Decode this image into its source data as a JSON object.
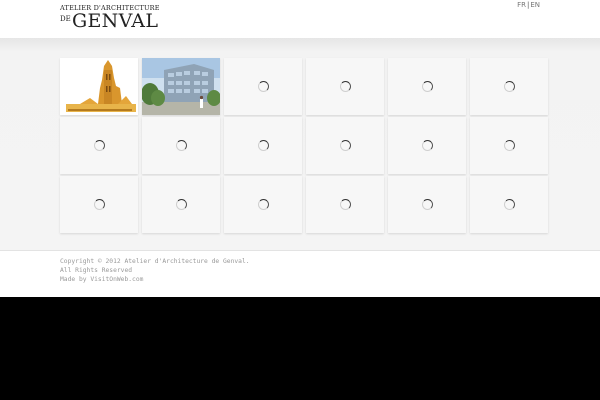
{
  "header": {
    "logo": {
      "line1": "ATELIER D'ARCHITECTURE",
      "de": "DE",
      "name": "GENVAL"
    },
    "lang": {
      "fr": "FR",
      "separator": "|",
      "en": "EN"
    }
  },
  "gallery": {
    "tiles": [
      {
        "type": "image",
        "icon": "cathedral-image"
      },
      {
        "type": "image",
        "icon": "office-building-image"
      },
      {
        "type": "loading",
        "icon": "loading-spinner-icon"
      },
      {
        "type": "loading",
        "icon": "loading-spinner-icon"
      },
      {
        "type": "loading",
        "icon": "loading-spinner-icon"
      },
      {
        "type": "loading",
        "icon": "loading-spinner-icon"
      },
      {
        "type": "loading",
        "icon": "loading-spinner-icon"
      },
      {
        "type": "loading",
        "icon": "loading-spinner-icon"
      },
      {
        "type": "loading",
        "icon": "loading-spinner-icon"
      },
      {
        "type": "loading",
        "icon": "loading-spinner-icon"
      },
      {
        "type": "loading",
        "icon": "loading-spinner-icon"
      },
      {
        "type": "loading",
        "icon": "loading-spinner-icon"
      },
      {
        "type": "loading",
        "icon": "loading-spinner-icon"
      },
      {
        "type": "loading",
        "icon": "loading-spinner-icon"
      },
      {
        "type": "loading",
        "icon": "loading-spinner-icon"
      },
      {
        "type": "loading",
        "icon": "loading-spinner-icon"
      },
      {
        "type": "loading",
        "icon": "loading-spinner-icon"
      },
      {
        "type": "loading",
        "icon": "loading-spinner-icon"
      }
    ]
  },
  "footer": {
    "copyright": "Copyright © 2012 Atelier d'Architecture de Genval. All Rights Reserved",
    "made_by": "Made by VisitOnWeb.com"
  },
  "colors": {
    "page_bg": "#ffffff",
    "gallery_bg": "#f4f4f4",
    "tile_bg": "#f7f7f7",
    "outer_bg": "#000000"
  }
}
